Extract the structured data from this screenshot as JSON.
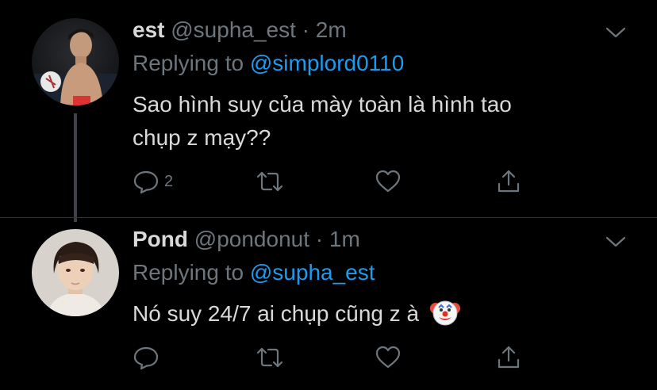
{
  "tweets": [
    {
      "name": "est",
      "handle": "@supha_est",
      "sep": "·",
      "time": "2m",
      "replying_prefix": "Replying to",
      "replying_to": "@simplord0110",
      "text_line1": "Sao hình suy của mày toàn là hình tao",
      "text_line2": "chụp z mạy??",
      "reply_count": "2"
    },
    {
      "name": "Pond",
      "handle": "@pondonut",
      "sep": "·",
      "time": "1m",
      "replying_prefix": "Replying to",
      "replying_to": "@supha_est",
      "text_line1": "Nó suy 24/7 ai chụp cũng z à",
      "emoji": "🤡"
    }
  ],
  "icons": [
    "reply-icon",
    "retweet-icon",
    "like-icon",
    "share-icon",
    "chevron-down-icon"
  ],
  "colors": {
    "background": "#000000",
    "text": "#d9d9d9",
    "muted": "#6e767d",
    "link": "#1d9bf0",
    "thread_line": "#3d4248"
  }
}
